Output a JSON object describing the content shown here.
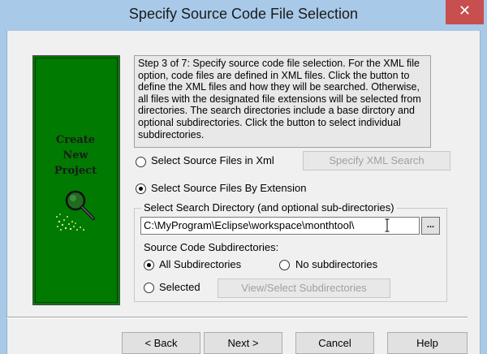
{
  "window": {
    "title": "Specify Source Code File Selection",
    "close_glyph": "✕"
  },
  "side_panel": {
    "line1": "Create",
    "line2": "New",
    "line3": "Project",
    "icon": "magnifier-icon"
  },
  "description": "Step 3 of 7: Specify source code file selection. For the XML file option, code files are defined in XML files. Click the button to define the XML files and how they will be searched. Otherwise, all files with the designated file extensions will be selected from directories. The search directories include a base dirctory and optional subdirectories. Click the button to select individual subdirectories.",
  "options": {
    "xml_label": "Select Source Files in Xml",
    "xml_checked": false,
    "specify_xml_button": "Specify XML Search",
    "ext_label": "Select Source Files By Extension",
    "ext_checked": true
  },
  "search_directory": {
    "group_title": "Select Search Directory (and optional sub-directories)",
    "path_value": "C:\\MyProgram\\Eclipse\\workspace\\monthtool\\",
    "browse_label": "..."
  },
  "subdirectories": {
    "heading": "Source Code Subdirectories:",
    "all_label": "All Subdirectories",
    "all_checked": true,
    "none_label": "No subdirectories",
    "none_checked": false,
    "selected_label": "Selected",
    "selected_checked": false,
    "view_select_button": "View/Select Subdirectories"
  },
  "footer": {
    "back": "< Back",
    "next": "Next >",
    "cancel": "Cancel",
    "help": "Help"
  }
}
